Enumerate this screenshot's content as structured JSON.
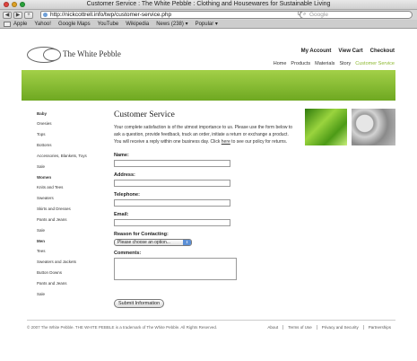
{
  "browser": {
    "window_title": "Customer Service : The White Pebble : Clothing and Housewares for Sustainable Living",
    "url": "http://nickcottrell.info/twp/customer-service.php",
    "search_placeholder": "Google",
    "back_label": "◀",
    "forward_label": "▶",
    "add_label": "+",
    "reload_label": "C",
    "bookmarks": [
      "Apple",
      "Yahoo!",
      "Google Maps",
      "YouTube",
      "Wikipedia",
      "News (238) ▾",
      "Popular ▾"
    ]
  },
  "site": {
    "logo_text": "The White Pebble",
    "account_links": [
      "My Account",
      "View Cart",
      "Checkout"
    ],
    "nav": [
      "Home",
      "Products",
      "Materials",
      "Story",
      "Customer Service"
    ],
    "active_nav": "Customer Service",
    "accent_color": "#8cb830"
  },
  "sidebar": {
    "groups": [
      {
        "heading": "Baby",
        "items": [
          "Onesies",
          "Tops",
          "Bottoms",
          "Accessories, Blankets, Toys",
          "Sale"
        ]
      },
      {
        "heading": "Women",
        "items": [
          "Knits and Tees",
          "Sweaters",
          "Skirts and Dresses",
          "Pants and Jeans",
          "Sale"
        ]
      },
      {
        "heading": "Men",
        "items": [
          "Tees",
          "Sweaters and Jackets",
          "Button Downs",
          "Pants and Jeans",
          "Sale"
        ]
      }
    ]
  },
  "main": {
    "title": "Customer Service",
    "intro_before": "Your complete satisfaction is of the utmost importance to us. Please use the form below to ask a question, provide feedback, track an order, initiate a return or exchange a product. You will receive a reply within one business day. Click ",
    "intro_link": "here",
    "intro_after": " to see our policy for returns.",
    "form": {
      "name_label": "Name:",
      "address_label": "Address:",
      "telephone_label": "Telephone:",
      "email_label": "Email:",
      "reason_label": "Reason for Contacting:",
      "reason_selected": "Please choose an option...",
      "comments_label": "Comments:",
      "submit_label": "Submit Information"
    }
  },
  "footer": {
    "copyright": "© 2007 The White Pebble. THE WHITE PEBBLE is a trademark of The White Pebble. All Rights Reserved.",
    "links": [
      "About",
      "Terms of Use",
      "Privacy and Security",
      "Partnerships"
    ]
  }
}
